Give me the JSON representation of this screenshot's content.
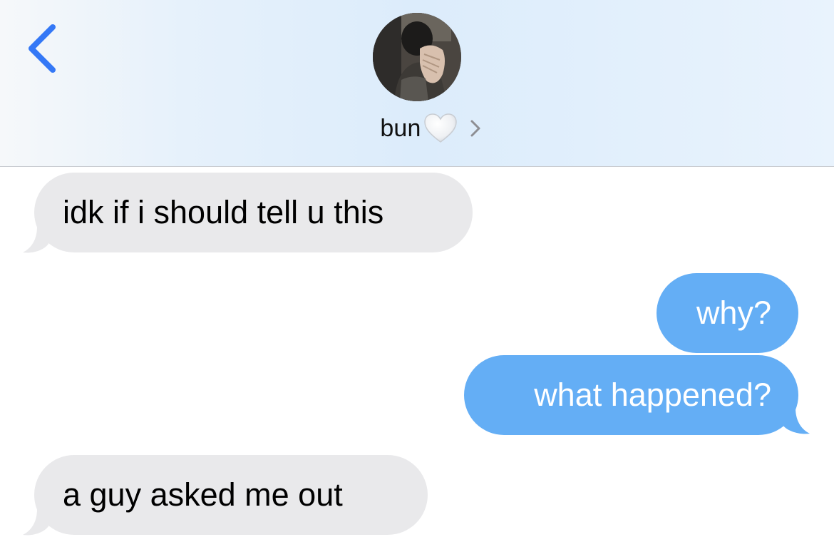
{
  "header": {
    "back_icon": "chevron-left-icon",
    "contact_name": "bun",
    "contact_emoji": "white-heart-icon",
    "details_icon": "chevron-right-icon",
    "accent_color": "#3478f6"
  },
  "messages": [
    {
      "direction": "received",
      "text": "idk if i should tell u this"
    },
    {
      "direction": "sent",
      "text": "why?"
    },
    {
      "direction": "sent",
      "text": "what happened?"
    },
    {
      "direction": "received",
      "text": "a guy asked me out"
    }
  ],
  "colors": {
    "received_bubble": "#e9e9eb",
    "sent_bubble": "#64aef5"
  }
}
